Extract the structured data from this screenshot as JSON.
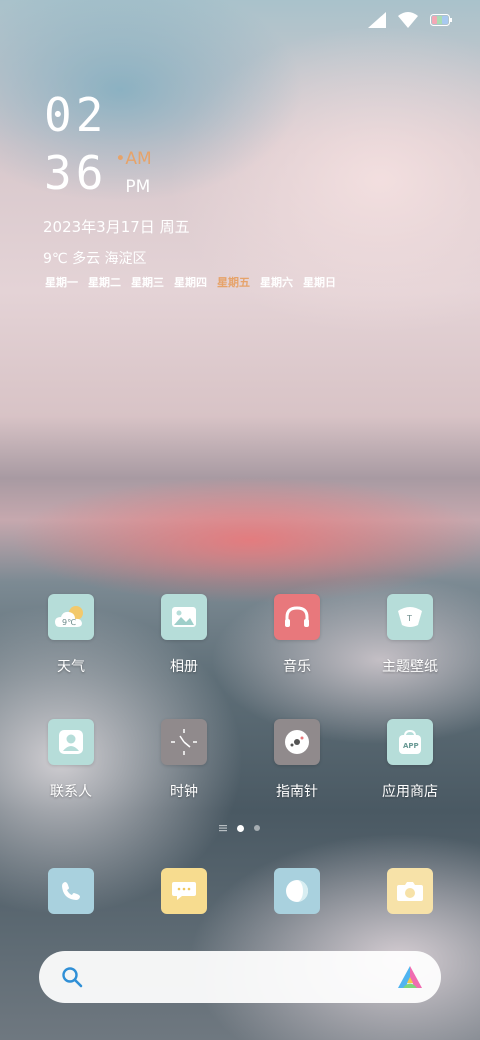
{
  "status_bar": {
    "signal_icon": "signal-icon",
    "wifi_icon": "wifi-icon",
    "battery_icon": "battery-icon"
  },
  "clock": {
    "hour": "02",
    "minute": "36",
    "am": "•AM",
    "pm": "PM"
  },
  "date": "2023年3月17日 周五",
  "weather": {
    "temp": "9℃",
    "condition": "多云",
    "location": "海淀区"
  },
  "weekdays": [
    "星期一",
    "星期二",
    "星期三",
    "星期四",
    "星期五",
    "星期六",
    "星期日"
  ],
  "active_weekday_index": 4,
  "apps": [
    {
      "label": "天气",
      "icon": "weather-icon",
      "icon_text": "9℃"
    },
    {
      "label": "相册",
      "icon": "gallery-icon"
    },
    {
      "label": "音乐",
      "icon": "music-icon"
    },
    {
      "label": "主题壁纸",
      "icon": "theme-icon"
    },
    {
      "label": "联系人",
      "icon": "contacts-icon"
    },
    {
      "label": "时钟",
      "icon": "clock-icon"
    },
    {
      "label": "指南针",
      "icon": "compass-icon"
    },
    {
      "label": "应用商店",
      "icon": "app-store-icon",
      "icon_text": "APP"
    }
  ],
  "dock": [
    {
      "icon": "phone-icon"
    },
    {
      "icon": "message-icon"
    },
    {
      "icon": "browser-icon"
    },
    {
      "icon": "camera-icon"
    }
  ],
  "page_indicator": {
    "current": 2,
    "total": 3
  },
  "search": {
    "search_icon": "search-icon",
    "assistant_icon": "assistant-logo-icon"
  },
  "colors": {
    "accent_orange": "#e6a36a",
    "weather_bg": "#b6ddd9",
    "music_bg": "#e8787c",
    "clock_bg": "#908a8c",
    "dock_phone": "#a9d1de",
    "dock_message": "#f7dc8f",
    "dock_browser": "#a9d1de",
    "dock_camera": "#f7e2a8"
  }
}
